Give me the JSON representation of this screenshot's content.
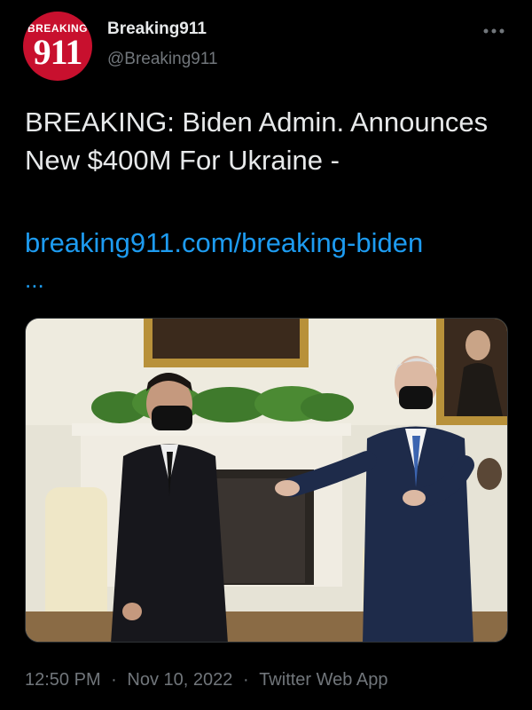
{
  "author": {
    "avatar_logo_top": "BREAKING",
    "avatar_logo_main": "911",
    "display_name": "Breaking911",
    "handle": "@Breaking911"
  },
  "tweet": {
    "text": "BREAKING: Biden Admin. Announces New $400M For Ukraine -",
    "link_text": "breaking911.com/breaking-biden",
    "ellipsis": "..."
  },
  "footer": {
    "time": "12:50 PM",
    "separator": "·",
    "date": "Nov 10, 2022",
    "source": "Twitter Web App"
  },
  "icons": {
    "more": "more-options-icon"
  },
  "colors": {
    "background": "#000000",
    "text": "#e7e9ea",
    "secondary_text": "#71767b",
    "link": "#1d9bf0",
    "avatar_brand": "#c8102e"
  }
}
